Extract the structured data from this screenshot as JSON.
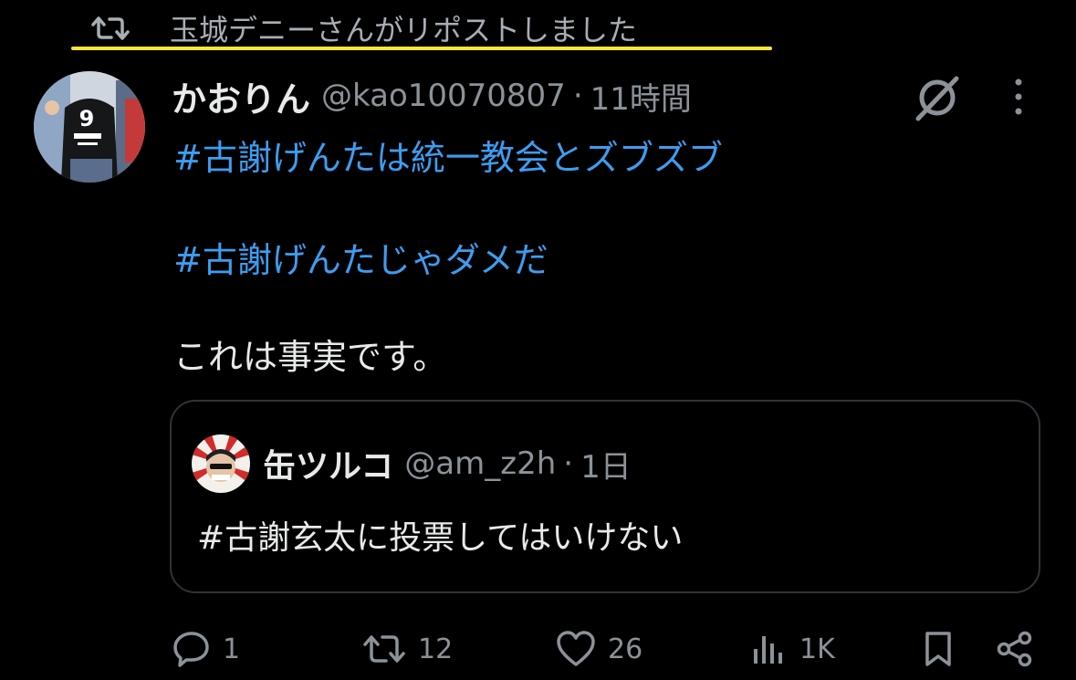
{
  "repost_banner": {
    "text": "玉城デニーさんがリポストしました",
    "icon": "repost-icon",
    "highlight_color": "#f5e63b"
  },
  "tweet": {
    "author": {
      "display_name": "かおりん",
      "handle": "@kao10070807",
      "separator": "·",
      "time": "11時間",
      "avatar_text": "9"
    },
    "lines": [
      "#古謝げんたは統一教会とズブズブ",
      "#古謝げんたじゃダメだ",
      "これは事実です。"
    ],
    "quote": {
      "display_name": "缶ツルコ",
      "handle": "@am_z2h",
      "separator": "·",
      "time": "1日",
      "text": "#古謝玄太に投票してはいけない"
    },
    "actions": {
      "replies": "1",
      "reposts": "12",
      "likes": "26",
      "views": "1K"
    }
  },
  "colors": {
    "background": "#000000",
    "text": "#e7e9ea",
    "secondary": "#8b9298",
    "hashtag": "#3d9df0",
    "border": "#2f3336"
  }
}
